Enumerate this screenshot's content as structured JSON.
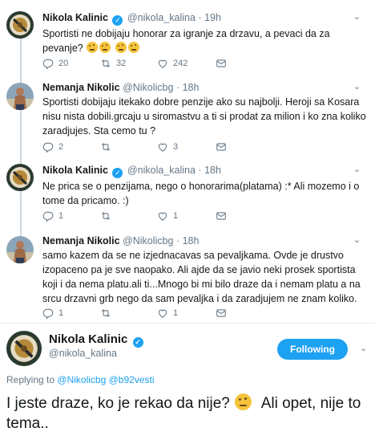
{
  "tweets": [
    {
      "name": "Nikola Kalinic",
      "verified": true,
      "handle": "@nikola_kalina",
      "time": "19h",
      "text": "Sportisti ne dobijaju honorar za igranje za drzavu, a pevaci da za pevanje?",
      "replies": "20",
      "retweets": "32",
      "likes": "242"
    },
    {
      "name": "Nemanja Nikolic",
      "verified": false,
      "handle": "@Nikolicbg",
      "time": "18h",
      "text": "Sportisti dobijaju itekako dobre penzije ako su najbolji. Heroji sa Kosara nisu nista dobili.grcaju u siromastvu a ti si prodat za milion i ko zna koliko zaradjujes. Sta cemo tu ?",
      "replies": "2",
      "retweets": "",
      "likes": "3"
    },
    {
      "name": "Nikola Kalinic",
      "verified": true,
      "handle": "@nikola_kalina",
      "time": "18h",
      "text": "Ne prica se o penzijama, nego o honorarima(platama) :*  Ali mozemo i o tome da pricamo. :)",
      "replies": "1",
      "retweets": "",
      "likes": "1"
    },
    {
      "name": "Nemanja Nikolic",
      "verified": false,
      "handle": "@Nikolicbg",
      "time": "18h",
      "text": "samo kazem da se ne izjednacavas sa pevaljkama. Ovde je drustvo izopaceno pa je sve naopako. Ali ajde da se javio neki prosek sportista koji i da nema platu.ali ti...Mnogo bi mi bilo draze da i nemam platu a na srcu drzavni grb nego da sam pevaljka i da zaradjujem ne znam koliko.",
      "replies": "1",
      "retweets": "",
      "likes": "1"
    }
  ],
  "sep": "·",
  "main_tweet": {
    "name": "Nikola Kalinic",
    "handle": "@nikola_kalina",
    "follow_label": "Following",
    "replying_prefix": "Replying to",
    "replying_to_1": "@Nikolicbg",
    "replying_to_2": "@b92vesti",
    "text_part1": "I jeste draze, ko je rekao da nije?",
    "text_part2": "Ali opet, nije to tema.."
  },
  "colors": {
    "accent": "#1da1f2",
    "muted": "#657786",
    "text": "#14171a"
  },
  "icons": [
    "reply-icon",
    "retweet-icon",
    "like-icon",
    "dm-icon",
    "chevron-down-icon",
    "verified-icon",
    "thinking-emoji"
  ]
}
